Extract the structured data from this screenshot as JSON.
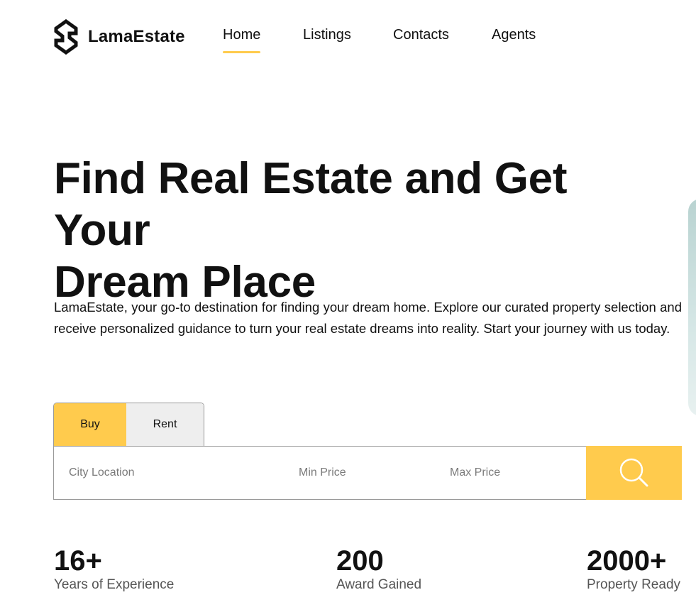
{
  "brand": {
    "name": "LamaEstate",
    "accent_color": "#FFCB4D"
  },
  "nav": {
    "items": [
      {
        "label": "Home",
        "active": true
      },
      {
        "label": "Listings",
        "active": false
      },
      {
        "label": "Contacts",
        "active": false
      },
      {
        "label": "Agents",
        "active": false
      }
    ]
  },
  "hero": {
    "title_line1": "Find Real Estate and Get Your",
    "title_line2": "Dream Place",
    "description": "LamaEstate, your go-to destination for finding your dream home. Explore our curated property selection and receive personalized guidance to turn your real estate dreams into reality. Start your journey with us today."
  },
  "search": {
    "tabs": [
      {
        "label": "Buy",
        "active": true
      },
      {
        "label": "Rent",
        "active": false
      }
    ],
    "city_placeholder": "City Location",
    "min_price_placeholder": "Min Price",
    "max_price_placeholder": "Max Price",
    "button_icon": "search-icon"
  },
  "stats": [
    {
      "value": "16+",
      "label": "Years of Experience"
    },
    {
      "value": "200",
      "label": "Award Gained"
    },
    {
      "value": "2000+",
      "label": "Property Ready"
    }
  ]
}
